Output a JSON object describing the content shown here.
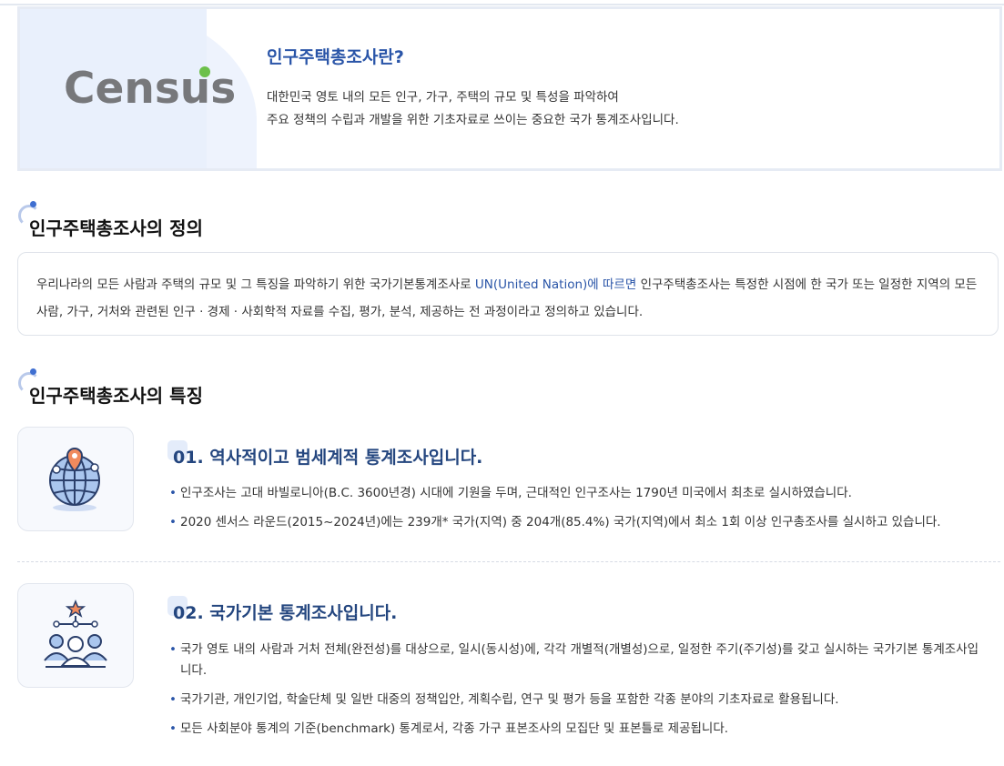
{
  "intro": {
    "logo_text": "Census",
    "title": "인구주택총조사란?",
    "desc_line1": "대한민국 영토 내의 모든 인구, 가구, 주택의 규모 및 특성을 파악하여",
    "desc_line2": "주요 정책의 수립과 개발을 위한 기초자료로 쓰이는 중요한 국가 통계조사입니다."
  },
  "definition": {
    "heading": "인구주택총조사의 정의",
    "text_part1": "우리나라의 모든 사람과 주택의 규모 및 그 특징을 파악하기 위한 국가기본통계조사로 ",
    "text_highlight": "UN(United Nation)에 따르면",
    "text_part2": " 인구주택총조사는 특정한 시점에 한 국가 또는 일정한 지역의 모든 사람, 가구, 거처와 관련된 인구 · 경제 · 사회학적 자료를 수집, 평가, 분석, 제공하는 전 과정이라고 정의하고 있습니다."
  },
  "features": {
    "heading": "인구주택총조사의 특징",
    "items": [
      {
        "icon": "globe-location-icon",
        "title": "01. 역사적이고 범세계적 통계조사입니다.",
        "bullets": [
          "인구조사는 고대 바빌로니아(B.C. 3600년경) 시대에 기원을 두며, 근대적인 인구조사는 1790년 미국에서 최초로 실시하였습니다.",
          "2020 센서스 라운드(2015~2024년)에는 239개* 국가(지역) 중 204개(85.4%) 국가(지역)에서 최소 1회 이상 인구총조사를 실시하고 있습니다."
        ]
      },
      {
        "icon": "people-hierarchy-icon",
        "title": "02. 국가기본 통계조사입니다.",
        "bullets": [
          "국가 영토 내의 사람과 거처 전체(완전성)를 대상으로, 일시(동시성)에, 각각 개별적(개별성)으로, 일정한 주기(주기성)를 갖고 실시하는 국가기본 통계조사입니다.",
          "국가기관, 개인기업, 학술단체 및 일반 대중의 정책입안, 계획수립, 연구 및 평가 등을 포함한 각종 분야의 기초자료로 활용됩니다.",
          "모든 사회분야 통계의 기준(benchmark) 통계로서, 각종 가구 표본조사의 모집단 및 표본틀로 제공됩니다."
        ]
      }
    ]
  },
  "colors": {
    "accent": "#2a55a8",
    "logo_green": "#6cc04a",
    "logo_gray": "#77787b"
  }
}
